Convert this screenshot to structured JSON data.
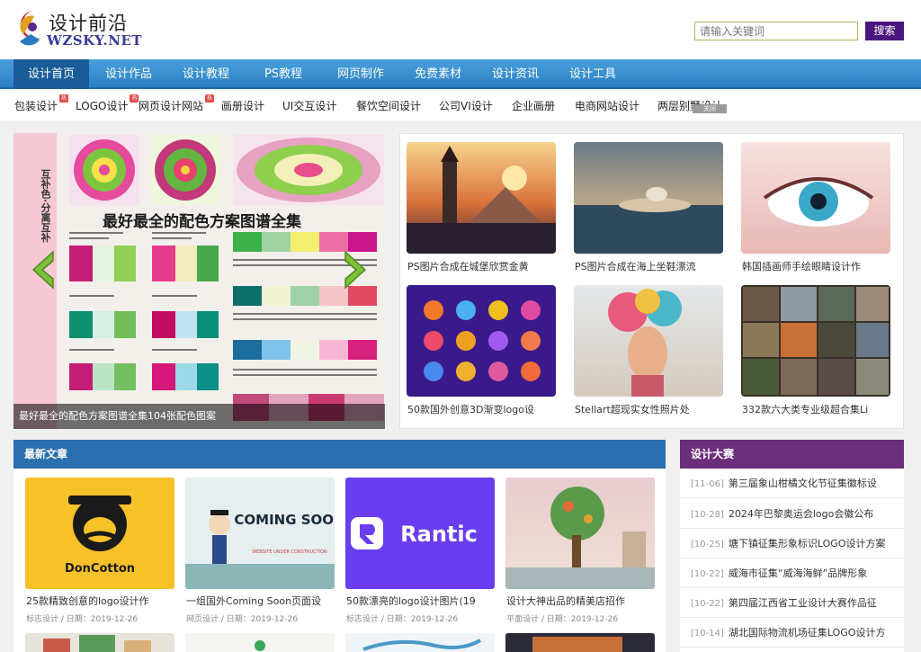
{
  "brand": {
    "name_cn": "设计前沿",
    "name_en": "WZSKY.NET"
  },
  "search": {
    "placeholder": "请输入关键词",
    "button": "搜索"
  },
  "nav": [
    {
      "label": "设计首页",
      "active": true
    },
    {
      "label": "设计作品"
    },
    {
      "label": "设计教程"
    },
    {
      "label": "PS教程"
    },
    {
      "label": "网页制作"
    },
    {
      "label": "免费素材"
    },
    {
      "label": "设计资讯"
    },
    {
      "label": "设计工具"
    }
  ],
  "subnav": [
    {
      "label": "包装设计",
      "hot": true
    },
    {
      "label": "LOGO设计",
      "hot": true
    },
    {
      "label": "网页设计网站",
      "hot": true
    },
    {
      "label": "画册设计"
    },
    {
      "label": "UI交互设计"
    },
    {
      "label": "餐饮空间设计"
    },
    {
      "label": "公司VI设计"
    },
    {
      "label": "企业画册"
    },
    {
      "label": "电商网站设计"
    },
    {
      "label": "两层别墅设计"
    }
  ],
  "subnav_hot_badge": "热",
  "subnav_close": "关闭",
  "slider": {
    "side_text": "互补色·分离互补",
    "title": "最好最全的配色方案图谱全集",
    "caption": "最好最全的配色方案图谱全集104张配色图案"
  },
  "featured": [
    {
      "caption": "PS图片合成在城堡欣赏金黄"
    },
    {
      "caption": "PS图片合成在海上坐鞋漂流"
    },
    {
      "caption": "韩国插画师手绘眼睛设计作"
    },
    {
      "caption": "50款国外创意3D渐变logo设"
    },
    {
      "caption": "Stellart超现实女性照片处"
    },
    {
      "caption": "332款六大类专业级超合集Li"
    }
  ],
  "latest": {
    "heading": "最新文章",
    "articles": [
      {
        "title": "25款精致创意的logo设计作",
        "meta": "标志设计 / 日期：2019-12-26",
        "img_text": "DonCotton"
      },
      {
        "title": "一组国外Coming Soon页面设",
        "meta": "网页设计 / 日期：2019-12-26",
        "img_text": "COMING SOON",
        "img_sub": "WEBSITE UNDER CONSTRUCTION"
      },
      {
        "title": "50款漂亮的logo设计图片(19",
        "meta": "标志设计 / 日期：2019-12-26",
        "img_text": "Rantic"
      },
      {
        "title": "设计大神出品的精美店招作",
        "meta": "平面设计 / 日期：2019-12-26"
      }
    ]
  },
  "contest": {
    "heading": "设计大赛",
    "items": [
      {
        "date": "[11-06]",
        "title": "第三届象山柑橘文化节征集徽标设"
      },
      {
        "date": "[10-28]",
        "title": "2024年巴黎奥运会logo会徽公布"
      },
      {
        "date": "[10-25]",
        "title": "塘下镇征集形象标识LOGO设计方案"
      },
      {
        "date": "[10-22]",
        "title": "威海市征集“威海海鲜”品牌形象"
      },
      {
        "date": "[10-22]",
        "title": "第四届江西省工业设计大赛作品征"
      },
      {
        "date": "[10-14]",
        "title": "湖北国际物流机场征集LOGO设计方"
      }
    ]
  },
  "colors": {
    "nav_blue": "#2a80c4",
    "nav_active": "#1a5c98",
    "search_button": "#4a1580",
    "latest_header": "#2a6fae",
    "contest_header": "#6b2f7a"
  }
}
